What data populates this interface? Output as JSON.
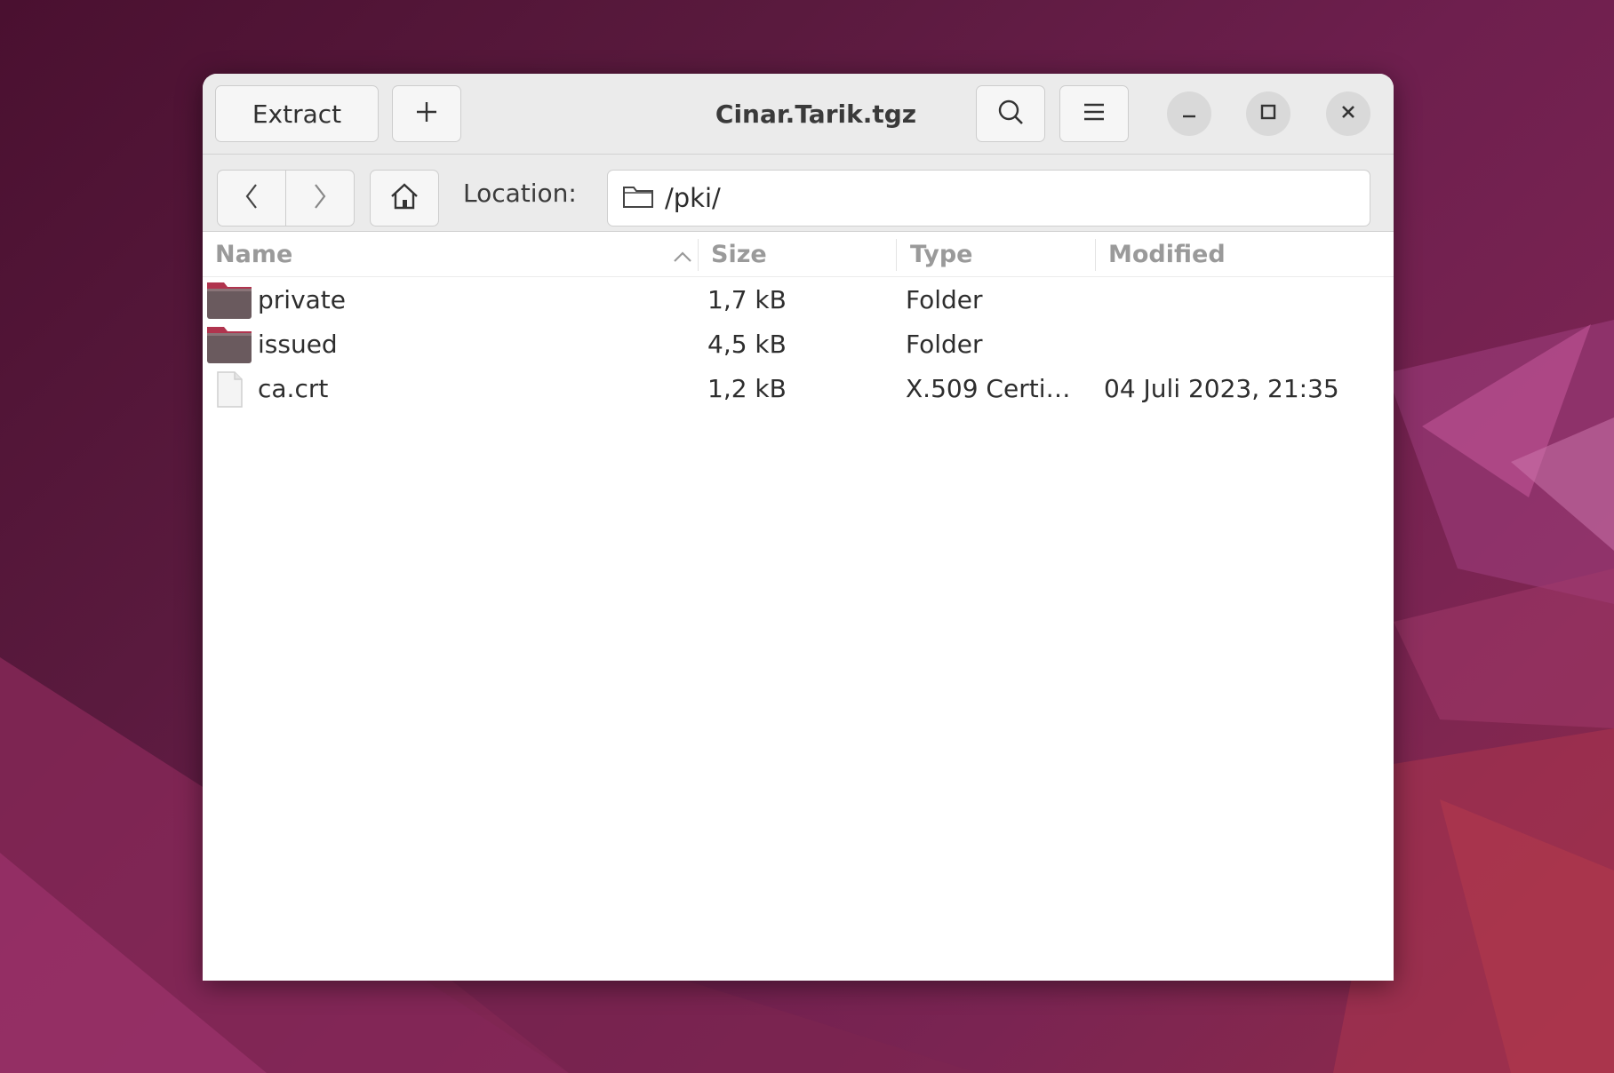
{
  "window": {
    "title": "Cinar.Tarik.tgz"
  },
  "headerbar": {
    "extract_label": "Extract",
    "add_label": "+",
    "search_icon": "search-icon",
    "menu_icon": "hamburger-menu-icon",
    "minimize_icon": "minimize-icon",
    "maximize_icon": "maximize-icon",
    "close_icon": "close-icon"
  },
  "toolbar": {
    "back_icon": "chevron-left-icon",
    "forward_icon": "chevron-right-icon",
    "home_icon": "home-icon",
    "location_label": "Location:",
    "location_value": "/pki/",
    "location_icon": "folder-outline-icon"
  },
  "columns": [
    {
      "label": "Name",
      "sort": "ascending"
    },
    {
      "label": "Size"
    },
    {
      "label": "Type"
    },
    {
      "label": "Modified"
    }
  ],
  "rows": [
    {
      "name": "private",
      "size": "1,7 kB",
      "type": "Folder",
      "modified": "",
      "icon": "folder-icon"
    },
    {
      "name": "issued",
      "size": "4,5 kB",
      "type": "Folder",
      "modified": "",
      "icon": "folder-icon"
    },
    {
      "name": "ca.crt",
      "size": "1,2 kB",
      "type": "X.509 Certi…",
      "modified": "04 Juli 2023, 21:35",
      "icon": "file-icon"
    }
  ],
  "colors": {
    "folder_tab": "#b0344e",
    "folder_body": "#6a5a5e",
    "header_bg": "#ebebeb"
  }
}
